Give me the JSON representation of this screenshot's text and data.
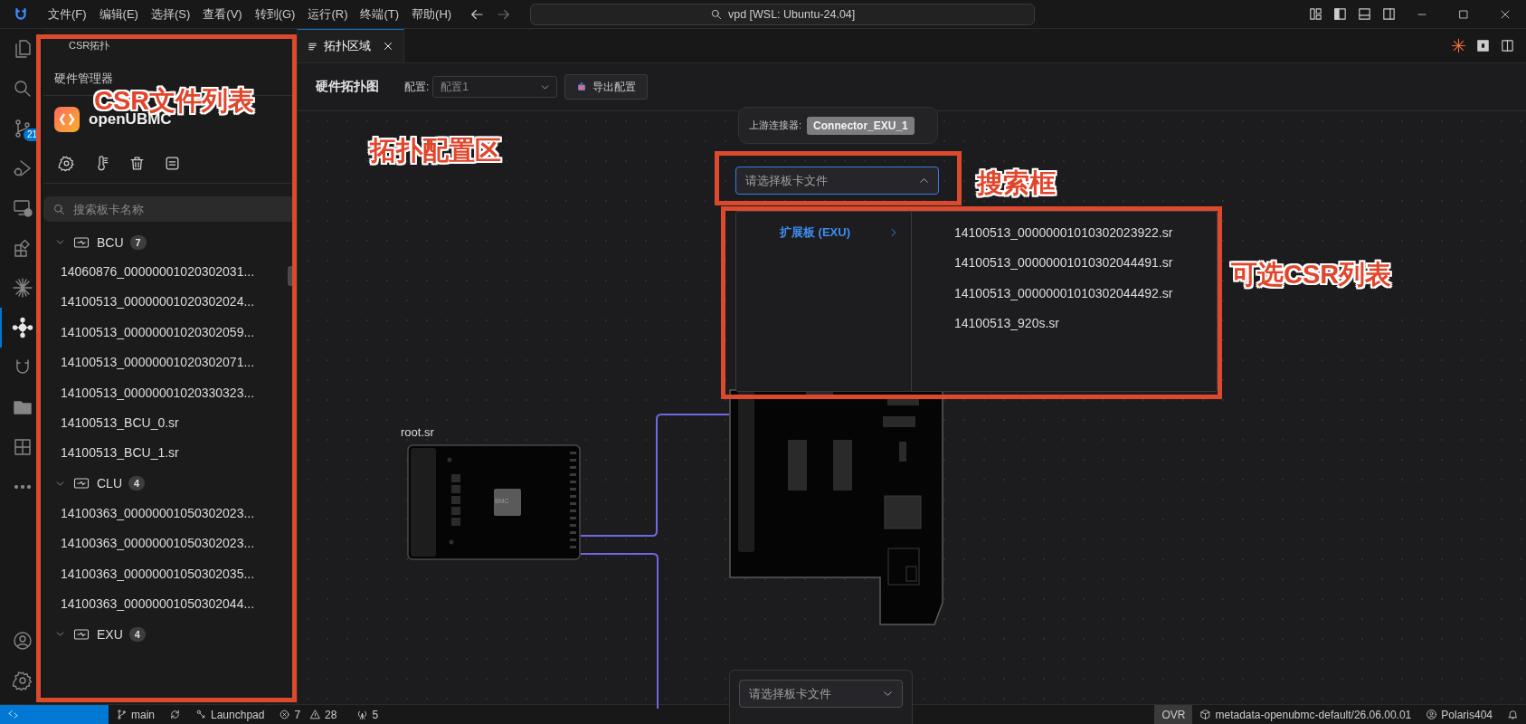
{
  "title_bar": {
    "menus": [
      "文件(F)",
      "编辑(E)",
      "选择(S)",
      "查看(V)",
      "转到(G)",
      "运行(R)",
      "终端(T)",
      "帮助(H)"
    ],
    "command_center": "vpd [WSL: Ubuntu-24.04]"
  },
  "activity_bar": {
    "items": [
      {
        "kind": "files",
        "selected": false
      },
      {
        "kind": "search",
        "selected": false
      },
      {
        "kind": "source-control",
        "selected": false,
        "badge": "21"
      },
      {
        "kind": "debug",
        "selected": false
      },
      {
        "kind": "remote",
        "selected": false
      },
      {
        "kind": "extensions",
        "selected": false
      },
      {
        "kind": "sparkle",
        "selected": false
      },
      {
        "kind": "topology",
        "selected": true
      },
      {
        "kind": "magnet",
        "selected": false
      },
      {
        "kind": "folder",
        "selected": false
      },
      {
        "kind": "blocks",
        "selected": false
      },
      {
        "kind": "more",
        "selected": false
      }
    ],
    "bottom": [
      {
        "kind": "account"
      },
      {
        "kind": "settings"
      }
    ]
  },
  "sidebar": {
    "title": "CSR拓扑",
    "section": "硬件管理器",
    "brand": "openUBMC",
    "tools": [
      {
        "kind": "settings"
      },
      {
        "kind": "thermometer"
      },
      {
        "kind": "trash"
      },
      {
        "kind": "list"
      }
    ],
    "search": {
      "placeholder": "搜索板卡名称"
    },
    "tree": [
      {
        "label": "BCU",
        "count": "7",
        "expanded": true,
        "children": [
          {
            "label": "14060876_00000001020302031..."
          },
          {
            "label": "14100513_00000001020302024..."
          },
          {
            "label": "14100513_00000001020302059..."
          },
          {
            "label": "14100513_00000001020302071..."
          },
          {
            "label": "14100513_00000001020330323..."
          },
          {
            "label": "14100513_BCU_0.sr"
          },
          {
            "label": "14100513_BCU_1.sr"
          }
        ]
      },
      {
        "label": "CLU",
        "count": "4",
        "expanded": true,
        "children": [
          {
            "label": "14100363_00000001050302023..."
          },
          {
            "label": "14100363_00000001050302023..."
          },
          {
            "label": "14100363_00000001050302035..."
          },
          {
            "label": "14100363_00000001050302044..."
          }
        ]
      },
      {
        "label": "EXU",
        "count": "4",
        "expanded": true
      }
    ]
  },
  "editor": {
    "tabs": [
      {
        "label": "拓扑区域",
        "selected": true
      }
    ],
    "toolbar": {
      "title": "硬件拓扑图",
      "config_label": "配置:",
      "config_value": "配置1",
      "export_button": "导出配置"
    },
    "canvas": {
      "connector_tooltip": {
        "label": "上游连接器:",
        "value": "Connector_EXU_1"
      },
      "board_select": {
        "placeholder": "请选择板卡文件",
        "expanded": true
      },
      "dropdown": {
        "categories": [
          {
            "label": "扩展板 (EXU)",
            "selected": true
          }
        ],
        "files": [
          "14100513_00000001010302023922.sr",
          "14100513_00000001010302044491.sr",
          "14100513_00000001010302044492.sr",
          "14100513_920s.sr"
        ]
      },
      "root_board": {
        "label": "root.sr",
        "chip": "BMC"
      },
      "lower_select": {
        "placeholder": "请选择板卡文件",
        "expanded": false
      }
    }
  },
  "status_bar": {
    "left": [
      {
        "kind": "remote"
      },
      {
        "kind": "branch",
        "text": "main"
      },
      {
        "kind": "sync"
      },
      {
        "kind": "launchpad",
        "text": "Launchpad"
      },
      {
        "kind": "problems",
        "errors": "7",
        "warnings": "28"
      },
      {
        "kind": "ports",
        "text": "5"
      }
    ],
    "right": [
      {
        "kind": "mode",
        "text": "OVR"
      },
      {
        "kind": "package",
        "text": "metadata-openubmc-default/26.06.00.01"
      },
      {
        "kind": "account",
        "text": "Polaris404"
      },
      {
        "kind": "bell"
      }
    ]
  },
  "annotations": [
    {
      "label": "CSR文件列表",
      "kind": "frame"
    },
    {
      "label": "拓扑配置区",
      "kind": "text"
    },
    {
      "label": "搜索框",
      "kind": "frame"
    },
    {
      "label": "可选CSR列表",
      "kind": "frame"
    }
  ]
}
